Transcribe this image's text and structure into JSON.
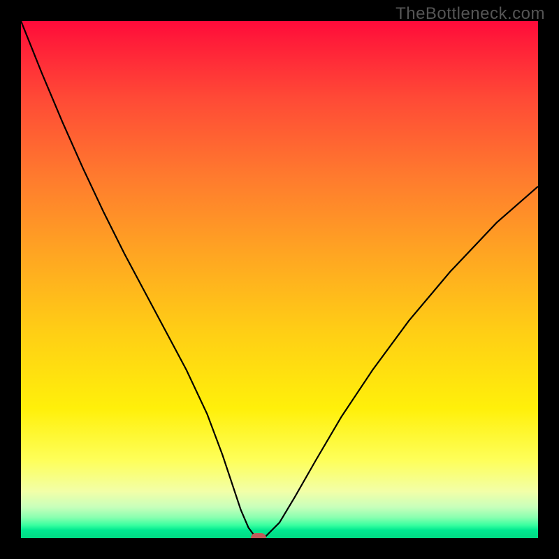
{
  "watermark": "TheBottleneck.com",
  "chart_data": {
    "type": "line",
    "title": "",
    "xlabel": "",
    "ylabel": "",
    "xlim": [
      0,
      100
    ],
    "ylim": [
      0,
      100
    ],
    "x": [
      0,
      4,
      8,
      12,
      16,
      20,
      24,
      28,
      32,
      36,
      39,
      41,
      42.5,
      44,
      45.5,
      47,
      50,
      53,
      57,
      62,
      68,
      75,
      83,
      92,
      100
    ],
    "y": [
      100,
      90,
      80.5,
      71.5,
      63,
      55,
      47.5,
      40,
      32.5,
      24,
      16,
      10,
      5.5,
      2,
      0,
      0,
      3,
      8,
      15,
      23.5,
      32.5,
      42,
      51.5,
      61,
      68
    ],
    "marker": {
      "x": 46,
      "y": 0
    },
    "gradient_stops": [
      {
        "pos": 0,
        "color": "#ff0a3a"
      },
      {
        "pos": 15,
        "color": "#ff4a36"
      },
      {
        "pos": 30,
        "color": "#ff7a2e"
      },
      {
        "pos": 45,
        "color": "#ffa522"
      },
      {
        "pos": 60,
        "color": "#ffce15"
      },
      {
        "pos": 75,
        "color": "#fff00a"
      },
      {
        "pos": 90,
        "color": "#f2ffa8"
      },
      {
        "pos": 97,
        "color": "#3affa0"
      },
      {
        "pos": 100,
        "color": "#00d983"
      }
    ]
  }
}
